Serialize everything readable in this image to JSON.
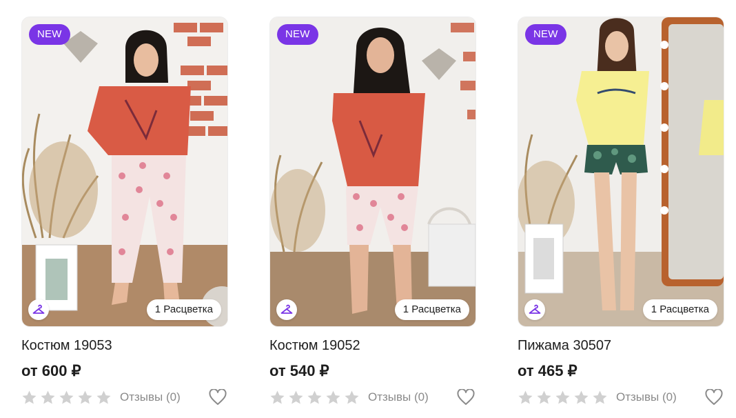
{
  "colors": {
    "accent": "#7a35e6",
    "star_empty": "#d0d0d0",
    "muted_text": "#8a8a8a"
  },
  "products": [
    {
      "badge": "NEW",
      "colors_label": "1 Расцветка",
      "name": "Костюм 19053",
      "price": "от 600 ₽",
      "reviews": "Отзывы (0)",
      "rating": 0
    },
    {
      "badge": "NEW",
      "colors_label": "1 Расцветка",
      "name": "Костюм 19052",
      "price": "от 540 ₽",
      "reviews": "Отзывы (0)",
      "rating": 0
    },
    {
      "badge": "NEW",
      "colors_label": "1 Расцветка",
      "name": "Пижама 30507",
      "price": "от 465 ₽",
      "reviews": "Отзывы (0)",
      "rating": 0
    }
  ]
}
